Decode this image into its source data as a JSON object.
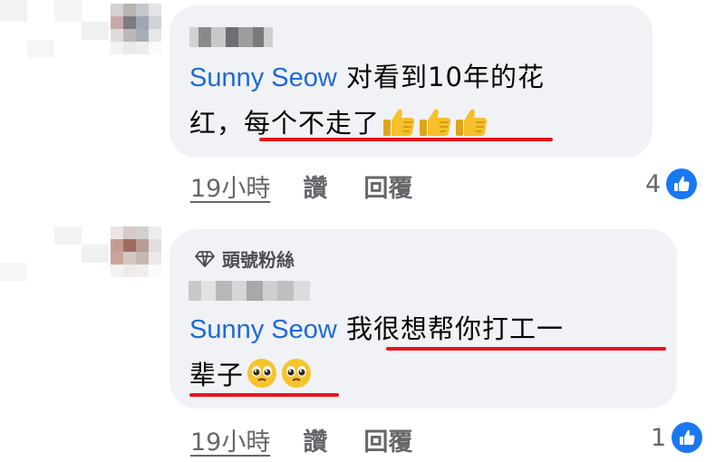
{
  "comments": [
    {
      "mention": "Sunny Seow",
      "line1": " 对看到10年的花",
      "line2_plain": "红，",
      "line2_underlined": "每个不走了",
      "emoji": [
        "thumbs-up",
        "thumbs-up",
        "thumbs-up"
      ],
      "time": "19小時",
      "like_label": "讚",
      "reply_label": "回覆",
      "reaction_count": "4"
    },
    {
      "badge": "頭號粉絲",
      "mention": "Sunny Seow",
      "line1": "我很想帮你打工一",
      "line2": "辈子",
      "emoji": [
        "pleading-face",
        "pleading-face"
      ],
      "time": "19小時",
      "like_label": "讚",
      "reply_label": "回覆",
      "reaction_count": "1"
    }
  ],
  "colors": {
    "mention": "#1d6ad8",
    "underline": "#e8141e",
    "bubble": "#f0f2f5",
    "meta": "#65676b",
    "like": "#1877f2"
  }
}
